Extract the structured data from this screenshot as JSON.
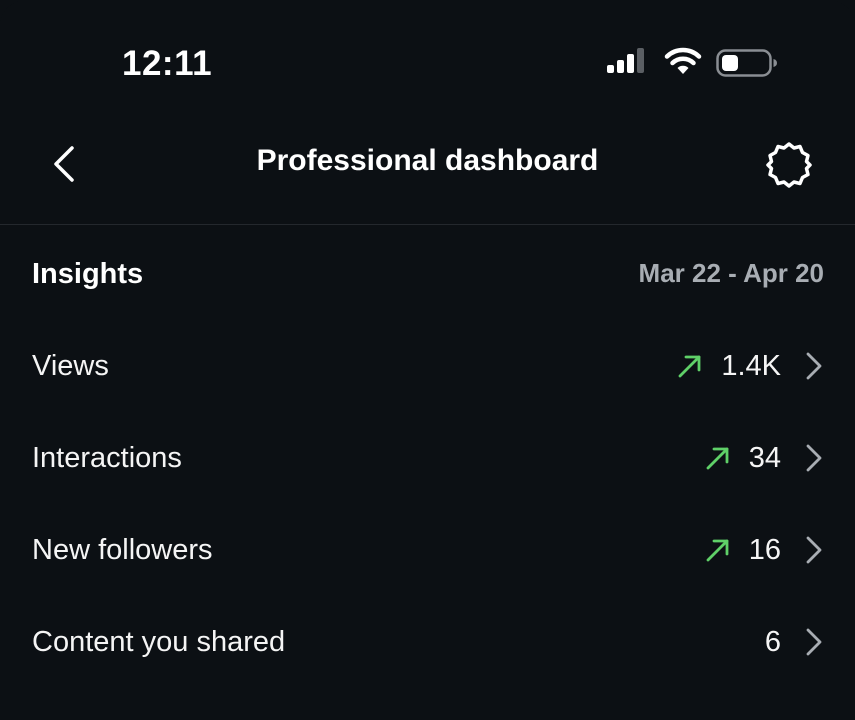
{
  "status_bar": {
    "time": "12:11",
    "icons": [
      "signal-icon",
      "wifi-icon",
      "battery-icon"
    ]
  },
  "nav": {
    "title": "Professional dashboard",
    "back_icon": "chevron-left-icon",
    "settings_icon": "gear-icon"
  },
  "insights": {
    "title": "Insights",
    "date_range": "Mar 22 - Apr 20",
    "rows": [
      {
        "label": "Views",
        "value": "1.4K",
        "trend": "up"
      },
      {
        "label": "Interactions",
        "value": "34",
        "trend": "up"
      },
      {
        "label": "New followers",
        "value": "16",
        "trend": "up"
      },
      {
        "label": "Content you shared",
        "value": "6",
        "trend": "none"
      }
    ]
  },
  "colors": {
    "background": "#0c1014",
    "text": "#f5f5f5",
    "muted": "#a8adb3",
    "trend_up": "#5fd068",
    "chevron": "#a8adb3"
  }
}
